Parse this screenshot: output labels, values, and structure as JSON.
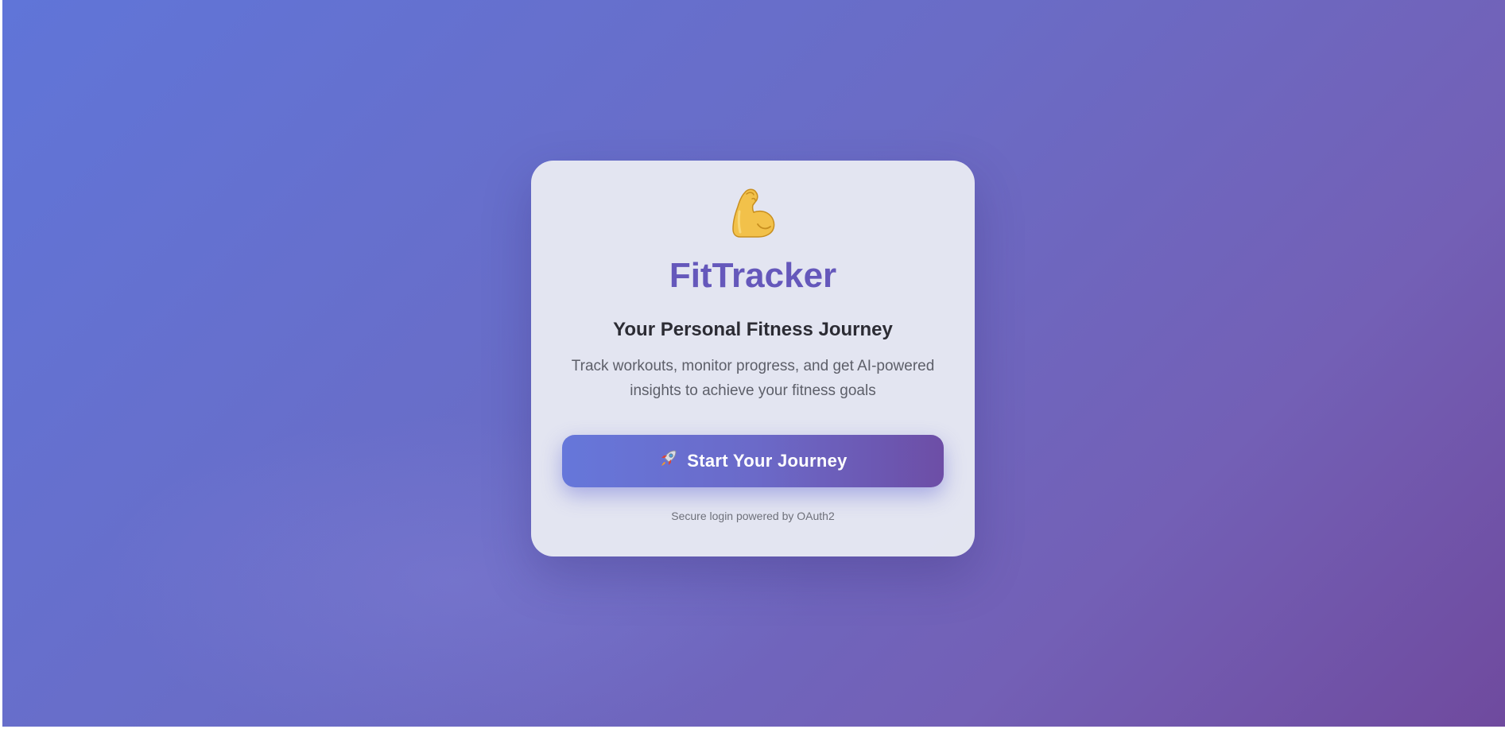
{
  "app": {
    "title": "FitTracker",
    "logo_icon": "flexed-biceps-icon"
  },
  "hero": {
    "subtitle": "Your Personal Fitness Journey",
    "description": "Track workouts, monitor progress, and get AI-powered insights to achieve your fitness goals"
  },
  "cta": {
    "icon": "rocket-icon",
    "label": "Start Your Journey"
  },
  "footer": {
    "note": "Secure login powered by OAuth2"
  },
  "colors": {
    "brand": "#6558bb",
    "background_start": "#6075d8",
    "background_end": "#6f4a9e",
    "button_start": "#6677da",
    "button_end": "#6d4ea6"
  }
}
